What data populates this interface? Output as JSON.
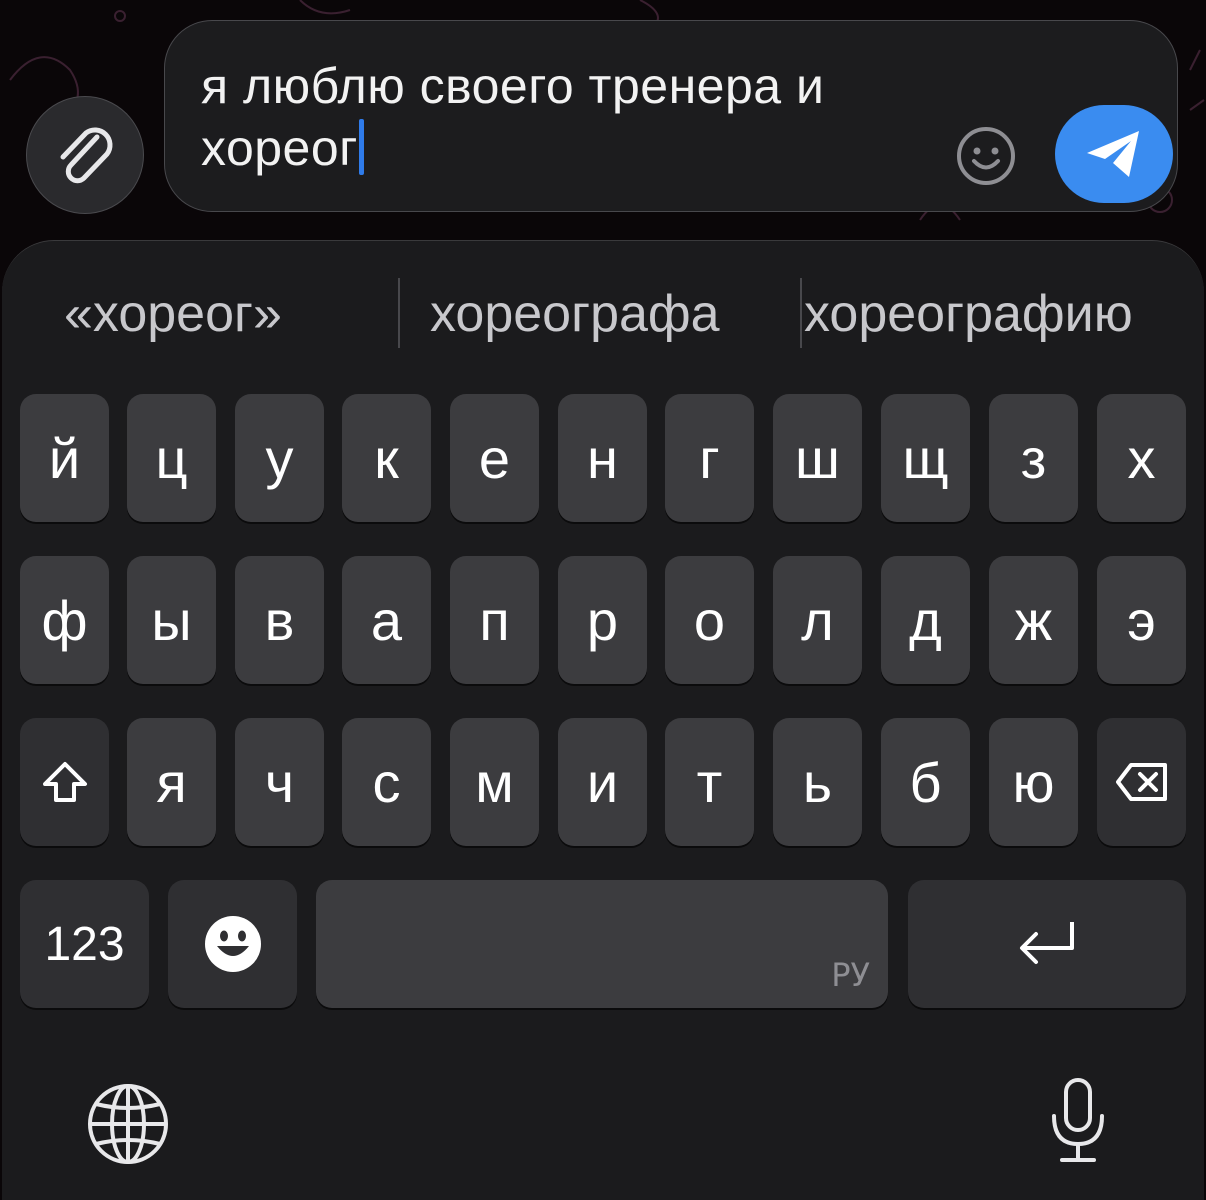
{
  "composer": {
    "text": "я люблю своего тренера и хореог"
  },
  "suggestions": [
    "«хореог»",
    "хореографа",
    "хореографию"
  ],
  "keyboard": {
    "row1": [
      "й",
      "ц",
      "у",
      "к",
      "е",
      "н",
      "г",
      "ш",
      "щ",
      "з",
      "х"
    ],
    "row2": [
      "ф",
      "ы",
      "в",
      "а",
      "п",
      "р",
      "о",
      "л",
      "д",
      "ж",
      "э"
    ],
    "row3": [
      "я",
      "ч",
      "с",
      "м",
      "и",
      "т",
      "ь",
      "б",
      "ю"
    ],
    "numbers_label": "123",
    "language_label": "РУ"
  },
  "icons": {
    "attach": "paperclip-icon",
    "emoji": "smiley-icon",
    "send": "paper-plane-icon",
    "shift": "shift-arrow-icon",
    "backspace": "backspace-icon",
    "emoji_key": "emoji-face-icon",
    "return": "return-arrow-icon",
    "globe": "globe-icon",
    "microphone": "microphone-icon"
  },
  "colors": {
    "send_button": "#3a8cf0",
    "caret": "#2f7bea",
    "key": "#3c3c3f",
    "keyboard_bg": "#1b1b1d"
  }
}
